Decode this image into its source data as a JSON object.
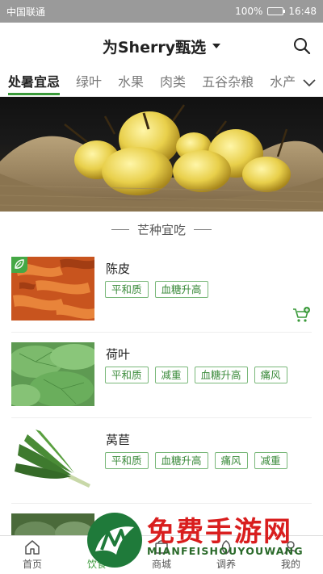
{
  "status_bar": {
    "carrier": "中国联通",
    "battery_percent": "100%",
    "battery_level": 1.0,
    "time": "16:48"
  },
  "header": {
    "title": "为Sherry甄选"
  },
  "tabs": [
    {
      "label": "处暑宜忌",
      "active": true
    },
    {
      "label": "绿叶",
      "active": false
    },
    {
      "label": "水果",
      "active": false
    },
    {
      "label": "肉类",
      "active": false
    },
    {
      "label": "五谷杂粮",
      "active": false
    },
    {
      "label": "水产",
      "active": false
    }
  ],
  "section": {
    "title": "芒种宜吃"
  },
  "items": [
    {
      "name": "陈皮",
      "tags": [
        "平和质",
        "血糖升高"
      ],
      "has_badge": true,
      "has_cart": true
    },
    {
      "name": "荷叶",
      "tags": [
        "平和质",
        "减重",
        "血糖升高",
        "痛风"
      ],
      "has_badge": false,
      "has_cart": false
    },
    {
      "name": "莴苣",
      "tags": [
        "平和质",
        "血糖升高",
        "痛风",
        "减重"
      ],
      "has_badge": false,
      "has_cart": false
    }
  ],
  "bottom_nav": [
    {
      "label": "首页",
      "icon": "home-icon",
      "active": false
    },
    {
      "label": "饮食",
      "icon": "food-icon",
      "active": true
    },
    {
      "label": "商城",
      "icon": "shop-icon",
      "active": false
    },
    {
      "label": "调养",
      "icon": "care-icon",
      "active": false
    },
    {
      "label": "我的",
      "icon": "profile-icon",
      "active": false
    }
  ],
  "watermark": {
    "title": "免费手游网",
    "subtitle": "MIANFEISHOUYOUWANG"
  },
  "colors": {
    "accent": "#3a9a3a",
    "status_bar": "#9a9a9a",
    "watermark_red": "#d91e1e"
  }
}
